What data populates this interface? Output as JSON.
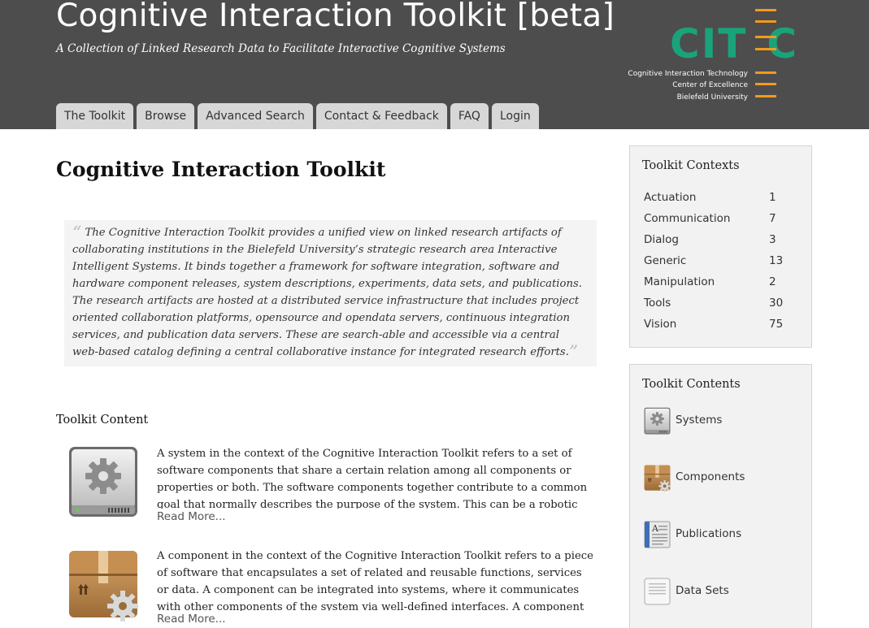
{
  "header": {
    "title": "Cognitive Interaction Toolkit [beta]",
    "subtitle": "A Collection of Linked Research Data to Facilitate Interactive Cognitive Systems",
    "logo": {
      "letters": "CIT C",
      "line1": "Cognitive Interaction Technology",
      "line2": "Center of Excellence",
      "line3": "Bielefeld University",
      "green": "#1aa37a",
      "orange": "#f39a1b"
    }
  },
  "nav": {
    "tabs": [
      {
        "label": "The Toolkit"
      },
      {
        "label": "Browse"
      },
      {
        "label": "Advanced Search"
      },
      {
        "label": "Contact & Feedback"
      },
      {
        "label": "FAQ"
      },
      {
        "label": "Login"
      }
    ]
  },
  "main": {
    "title": "Cognitive Interaction Toolkit",
    "quote": "The Cognitive Interaction Toolkit provides a unified view on linked research artifacts of collaborating institutions in the Bielefeld University’s strategic research area Interactive Intelligent Systems. It binds together a framework for software integration, software and hardware component releases, system descriptions, experiments, data sets, and publications. The research artifacts are hosted at a distributed service infrastructure that includes project oriented collaboration platforms, opensource and opendata servers, continuous integration services, and publication data servers. These are search-able and accessible via a central web-based catalog defining a central collaborative instance for integrated research efforts.",
    "section_title": "Toolkit Content",
    "items": [
      {
        "icon": "system-drive-icon",
        "text": "A system in the context of the Cognitive Interaction Toolkit refers to a set of software components that share a certain relation among all components or properties or both. The software components together contribute to a common goal that normally describes the purpose of the system. This can be a robotic platform that needs to",
        "read_more": "Read More..."
      },
      {
        "icon": "component-box-icon",
        "text": "A component in the context of the Cognitive Interaction Toolkit refers to a piece of software that encapsulates a set of related and reusable functions, services or data. A component can be integrated into systems, where it communicates with other components of the system via well-defined interfaces. A component can also offer",
        "read_more": "Read More..."
      }
    ]
  },
  "sidebar": {
    "contexts": {
      "title": "Toolkit Contexts",
      "rows": [
        {
          "label": "Actuation",
          "count": "1"
        },
        {
          "label": "Communication",
          "count": "7"
        },
        {
          "label": "Dialog",
          "count": "3"
        },
        {
          "label": "Generic",
          "count": "13"
        },
        {
          "label": "Manipulation",
          "count": "2"
        },
        {
          "label": "Tools",
          "count": "30"
        },
        {
          "label": "Vision",
          "count": "75"
        }
      ]
    },
    "contents": {
      "title": "Toolkit Contents",
      "rows": [
        {
          "label": "Systems",
          "icon": "system-drive-icon"
        },
        {
          "label": "Components",
          "icon": "component-box-icon"
        },
        {
          "label": "Publications",
          "icon": "publication-book-icon"
        },
        {
          "label": "Data Sets",
          "icon": "data-set-icon"
        }
      ]
    }
  }
}
